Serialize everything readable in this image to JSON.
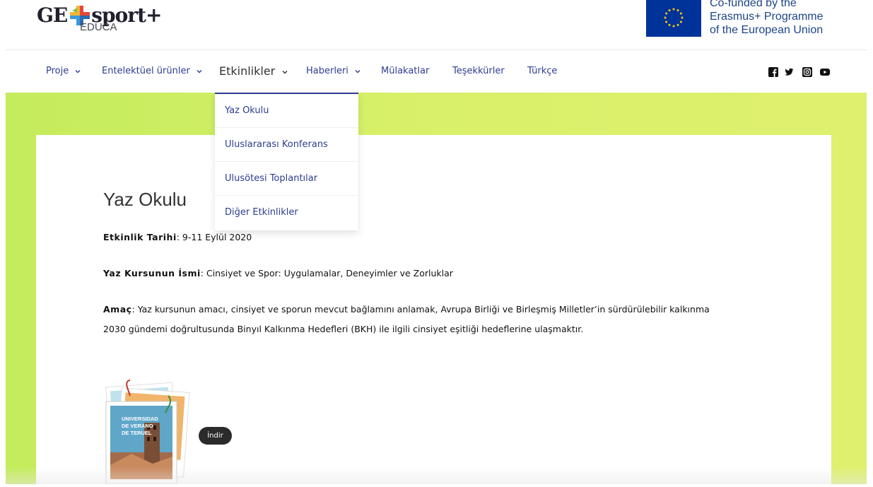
{
  "header": {
    "logo_left": "GE",
    "logo_right": "sport+",
    "logo_sub": "EDUCA",
    "eu_line1": "Co-funded by the",
    "eu_line2": "Erasmus+ Programme",
    "eu_line3": "of the European Union"
  },
  "nav": {
    "items": [
      {
        "label": "Proje",
        "has_dropdown": true
      },
      {
        "label": "Entelektüel ürünler",
        "has_dropdown": true
      },
      {
        "label": "Etkinlikler",
        "has_dropdown": true
      },
      {
        "label": "Haberleri",
        "has_dropdown": true
      },
      {
        "label": "Mülakatlar",
        "has_dropdown": false
      },
      {
        "label": "Teşekkürler",
        "has_dropdown": false
      },
      {
        "label": "Türkçe",
        "has_dropdown": false
      }
    ],
    "social_icons": [
      "facebook-icon",
      "twitter-icon",
      "instagram-icon",
      "youtube-icon"
    ]
  },
  "dropdown": {
    "items": [
      "Yaz Okulu",
      "Uluslararası Konferans",
      "Ulusötesi Toplantılar",
      "Diğer Etkinlikler"
    ]
  },
  "content": {
    "title": "Yaz Okulu",
    "date_label": "Etkinlik Tarihi",
    "date_value": ": 9-11 Eylül 2020",
    "course_label": "Yaz Kursunun İsmi",
    "course_value": ": Cinsiyet ve Spor: Uygulamalar, Deneyimler ve Zorluklar",
    "aim_label": "Amaç",
    "aim_line1": ": Yaz kursunun amacı, cinsiyet ve sporun mevcut bağlamını anlamak, Avrupa Birliği ve Birleşmiş Milletler’in sürdürülebilir kalkınma",
    "aim_line2": "2030 gündemi doğrultusunda Binyıl Kalkınma Hedefleri (BKH) ile ilgili cinsiyet eşitliği hedeflerine ulaşmaktır.",
    "poster_line1": "UNIVERSIDAD",
    "poster_line2": "DE VERANO",
    "poster_line3": "DE TERUEL",
    "download_label": "İndir"
  },
  "colors": {
    "nav_text": "#2d3d91",
    "band_green": "#d9f06a",
    "eu_blue": "#003399",
    "eu_text": "#1c4587",
    "download_bg": "#2b2b2b"
  }
}
